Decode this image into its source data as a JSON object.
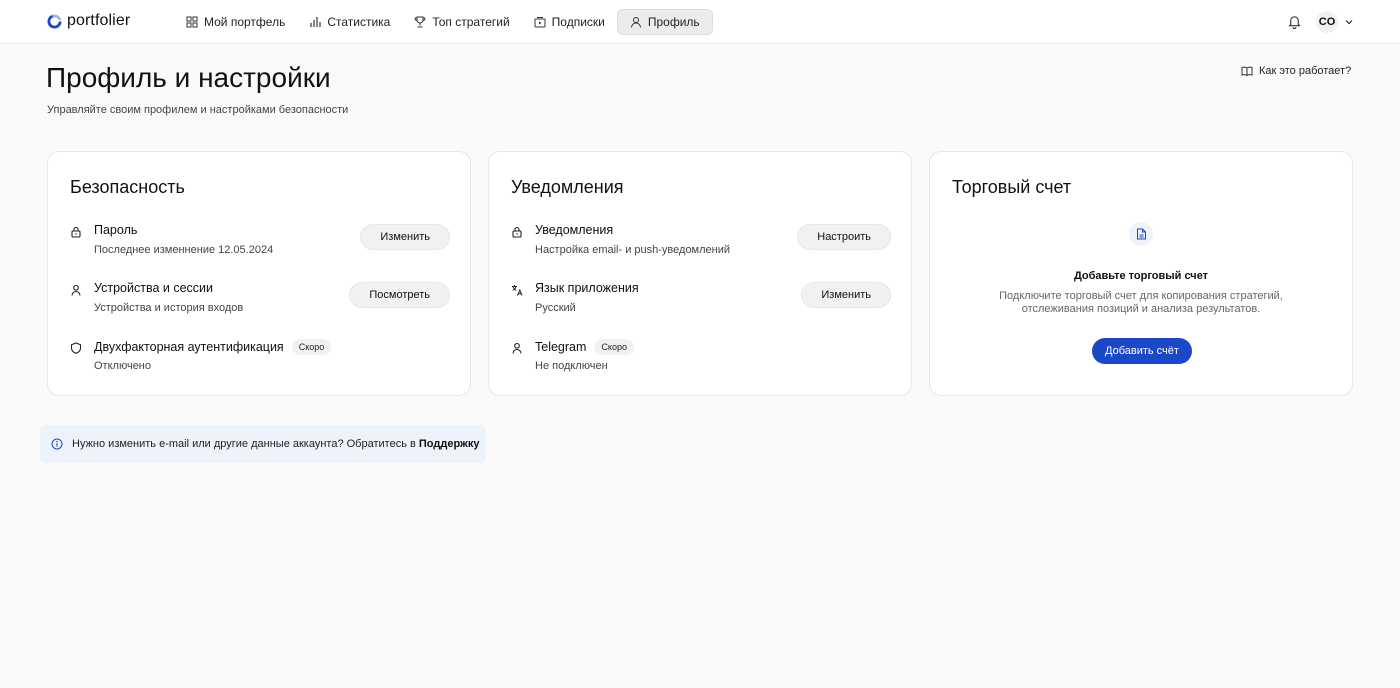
{
  "app": {
    "name": "portfolier"
  },
  "nav": [
    {
      "label": "Мой портфель",
      "icon": "grid-icon"
    },
    {
      "label": "Статистика",
      "icon": "chart-icon"
    },
    {
      "label": "Топ стратегий",
      "icon": "trophy-icon"
    },
    {
      "label": "Подписки",
      "icon": "subscriptions-icon"
    },
    {
      "label": "Профиль",
      "icon": "user-icon",
      "active": true
    }
  ],
  "user": {
    "initials": "CO"
  },
  "header": {
    "title": "Профиль и настройки",
    "subtitle": "Управляйте своим профилем и настройками безопасности",
    "help_link": "Как это работает?"
  },
  "security": {
    "title": "Безопасность",
    "password": {
      "title": "Пароль",
      "sub": "Последнее изменнение 12.05.2024",
      "button": "Изменить"
    },
    "devices": {
      "title": "Устройства и сессии",
      "sub": "Устройства и история входов",
      "button": "Посмотреть"
    },
    "twofa": {
      "title": "Двухфакторная аутентификация",
      "badge": "Скоро",
      "sub": "Отключено"
    }
  },
  "notifications": {
    "title": "Уведомления",
    "notif": {
      "title": "Уведомления",
      "sub": "Настройка email- и push-уведомлений",
      "button": "Настроить"
    },
    "language": {
      "title": "Язык приложения",
      "sub": "Русский",
      "button": "Изменить"
    },
    "telegram": {
      "title": "Telegram",
      "badge": "Скоро",
      "sub": "Не подключен"
    }
  },
  "trading": {
    "title": "Торговый счет",
    "empty_title": "Добавьте торговый счет",
    "empty_sub": "Подключите торговый счет для копирования стратегий, отслеживания позиций и анализа результатов.",
    "button": "Добавить счёт"
  },
  "info": {
    "text": "Нужно изменить e-mail или другие данные аккаунта? Обратитесь в ",
    "link": "Поддержку"
  },
  "colors": {
    "accent": "#1a48c8",
    "info_bg": "#eef3fb"
  }
}
